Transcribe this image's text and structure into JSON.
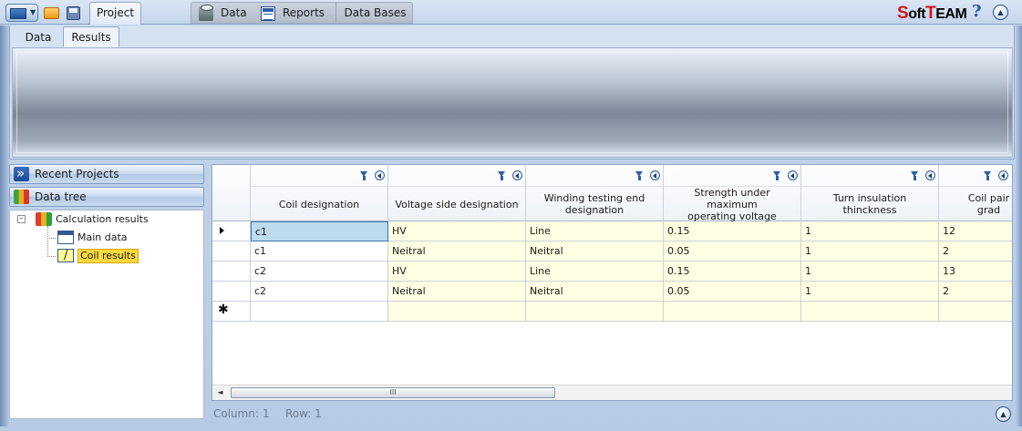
{
  "menubar": {
    "project_tab": "Project",
    "data_tab": "Data",
    "reports_tab": "Reports",
    "databases_tab": "Data Bases",
    "brand": {
      "s": "S",
      "oft": "oft",
      "t": "T",
      "eam": "EAM"
    },
    "help": "?",
    "icons": [
      "app-menu-icon",
      "open-folder-icon",
      "save-icon",
      "data-icon",
      "reports-icon",
      "help-icon",
      "collapse-up-icon"
    ]
  },
  "ribbon": {
    "tabs": [
      {
        "label": "Data"
      },
      {
        "label": "Results"
      }
    ],
    "active_tab": "Results"
  },
  "left_panel": {
    "recent_projects": "Recent Projects",
    "data_tree": "Data tree",
    "tree": {
      "root": "Calculation results",
      "expander": "–",
      "children": [
        {
          "label": "Main data"
        },
        {
          "label": "Coil results"
        }
      ],
      "selected": "Coil results"
    }
  },
  "grid": {
    "columns": [
      "Coil designation",
      "Voltage side designation",
      "Winding testing end\ndesignation",
      "Strength under maximum\noperating voltage",
      "Turn insulation thinckness",
      "Coil pair grad"
    ],
    "rows": [
      [
        "c1",
        "HV",
        "Line",
        "0.15",
        "1",
        "12"
      ],
      [
        "c1",
        "Neitral",
        "Neitral",
        "0.05",
        "1",
        "2"
      ],
      [
        "c2",
        "HV",
        "Line",
        "0.15",
        "1",
        "13"
      ],
      [
        "c2",
        "Neitral",
        "Neitral",
        "0.05",
        "1",
        "2"
      ]
    ],
    "new_row_marker": "✱",
    "scroll_grip": "III",
    "scroll_left": "◄"
  },
  "status": {
    "column": "Column: 1",
    "row": "Row: 1"
  },
  "colors": {
    "accent": "#2f5fa8",
    "selected_cell": "#bcdcee",
    "editable_cell": "#ffffe3",
    "brand_red": "#d01616"
  }
}
